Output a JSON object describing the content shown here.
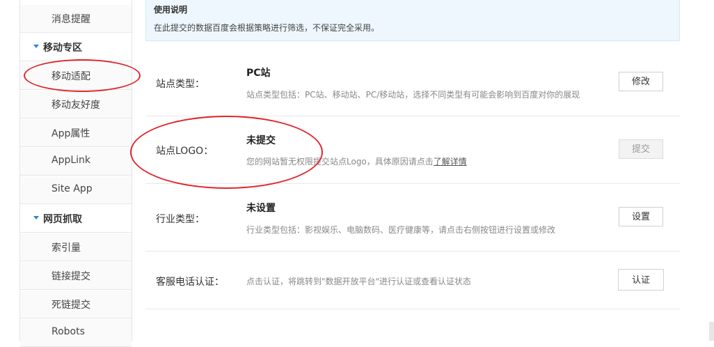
{
  "sidebar": {
    "items": [
      {
        "label": "消息提醒"
      },
      {
        "label": "移动适配"
      },
      {
        "label": "移动友好度"
      },
      {
        "label": "App属性"
      },
      {
        "label": "AppLink"
      },
      {
        "label": "Site App"
      },
      {
        "label": "索引量"
      },
      {
        "label": "链接提交"
      },
      {
        "label": "死链提交"
      },
      {
        "label": "Robots"
      }
    ],
    "sections": [
      {
        "label": "移动专区"
      },
      {
        "label": "网页抓取"
      }
    ]
  },
  "notice": {
    "title": "使用说明",
    "text": "在此提交的数据百度会根据策略进行筛选，不保证完全采用。"
  },
  "rows": {
    "site_type": {
      "key": "站点类型：",
      "value": "PC站",
      "desc": "站点类型包括：PC站、移动站、PC/移动站，选择不同类型有可能会影响到百度对你的展现",
      "button": "修改"
    },
    "site_logo": {
      "key": "站点LOGO：",
      "value": "未提交",
      "desc": "您的网站暂无权限提交站点Logo，具体原因请点击",
      "link": "了解详情",
      "button": "提交"
    },
    "industry": {
      "key": "行业类型：",
      "value": "未设置",
      "desc": "行业类型包括：影视娱乐、电脑数码、医疗健康等，请点击右侧按钮进行设置或修改",
      "button": "设置"
    },
    "phone": {
      "key": "客服电话认证：",
      "desc": "点击认证，将跳转到\"数据开放平台\"进行认证或查看认证状态",
      "button": "认证"
    }
  },
  "colors": {
    "annotation_red": "#e0262b",
    "caret_blue": "#2a86d6",
    "notice_bg": "#eef7fe"
  }
}
